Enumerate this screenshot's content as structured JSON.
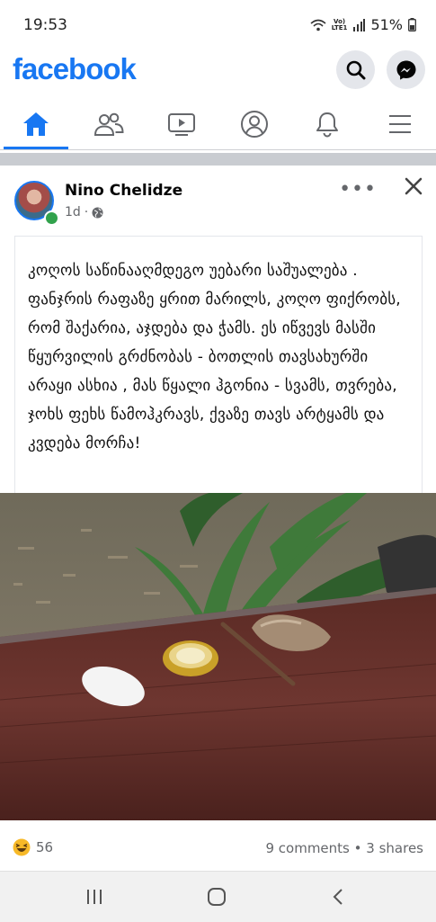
{
  "status_bar": {
    "time": "19:53",
    "network": "LTE1",
    "volte": "Vo)",
    "battery": "51%"
  },
  "app": {
    "logo": "facebook",
    "brand_color": "#1877f2"
  },
  "header_buttons": [
    {
      "icon": "search-icon"
    },
    {
      "icon": "messenger-icon"
    }
  ],
  "tabs": [
    {
      "icon": "home-icon",
      "active": true
    },
    {
      "icon": "friends-icon",
      "active": false
    },
    {
      "icon": "watch-icon",
      "active": false
    },
    {
      "icon": "profile-icon",
      "active": false
    },
    {
      "icon": "notifications-icon",
      "active": false
    },
    {
      "icon": "menu-icon",
      "active": false
    }
  ],
  "post": {
    "author": "Nino Chelidze",
    "time": "1d",
    "privacy_icon": "globe-icon",
    "text": "კოღოს საწინააღმდეგო უებარი საშუალება .\nფანჯრის რაფაზე ყრით მარილს, კოღო ფიქრობს, რომ შაქარია, აჯდება და ჭამს. ეს იწვევს მასში წყურვილის გრძნობას - ბოთლის თავსახურში არაყი ასხია , მას წყალი ჰგონია - სვამს, თვრება, ჯოხს ფეხს წამოჰკრავს, ქვაზე თავს არტყამს და კვდება  მორჩა!",
    "reaction_icon": "haha-reaction-icon",
    "reaction_count": "56",
    "comments": "9 comments",
    "shares": "3 shares"
  },
  "system_nav": [
    {
      "icon": "recent-apps-icon"
    },
    {
      "icon": "home-button-icon"
    },
    {
      "icon": "back-icon"
    }
  ]
}
